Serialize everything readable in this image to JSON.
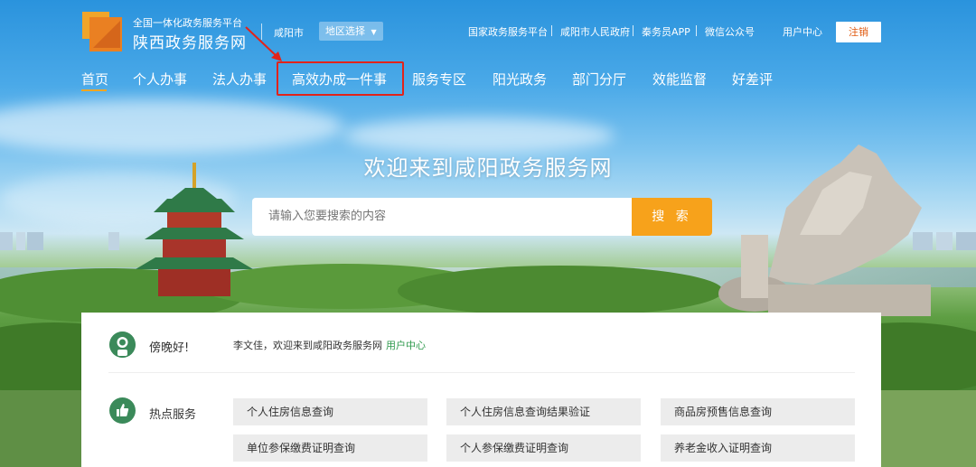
{
  "header": {
    "platform_small": "全国一体化政务服务平台",
    "platform_name": "陕西政务服务网",
    "city": "咸阳市",
    "region_select": "地区选择",
    "links": [
      "国家政务服务平台",
      "咸阳市人民政府",
      "秦务员APP",
      "微信公众号"
    ],
    "user_center": "用户中心",
    "logout": "注销"
  },
  "nav": {
    "items": [
      "首页",
      "个人办事",
      "法人办事",
      "高效办成一件事",
      "服务专区",
      "阳光政务",
      "部门分厅",
      "效能监督",
      "好差评"
    ],
    "active_index": 0,
    "highlighted_index": 3
  },
  "hero": {
    "welcome": "欢迎来到咸阳政务服务网",
    "search_placeholder": "请输入您要搜索的内容",
    "search_button": "搜 索"
  },
  "user_panel": {
    "greeting": "傍晚好!",
    "welcome_text": "李文佳，欢迎来到咸阳政务服务网",
    "user_center_link": "用户中心"
  },
  "hot_services": {
    "label": "热点服务",
    "items": [
      "个人住房信息查询",
      "个人住房信息查询结果验证",
      "商品房预售信息查询",
      "单位参保缴费证明查询",
      "个人参保缴费证明查询",
      "养老金收入证明查询"
    ]
  },
  "colors": {
    "accent_orange": "#f7a21b",
    "highlight_red": "#e2231a",
    "green": "#2f9a4d"
  }
}
